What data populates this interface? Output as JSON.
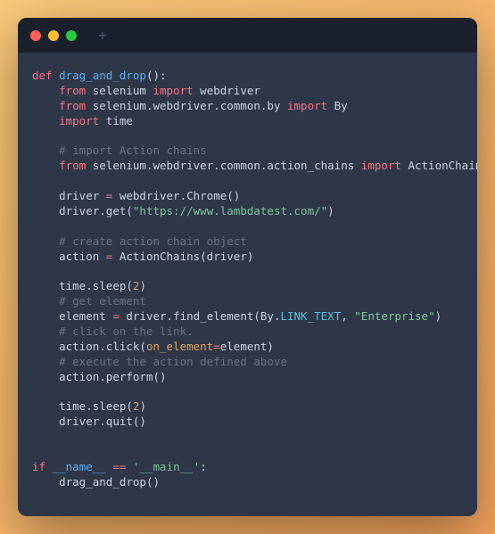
{
  "titlebar": {
    "plus": "+"
  },
  "code": {
    "l0_def": "def",
    "l0_fn": "drag_and_drop",
    "l0_rest": "():",
    "l1_from": "from",
    "l1_mod": " selenium ",
    "l1_import": "import",
    "l1_name": " webdriver",
    "l2_from": "from",
    "l2_mod": " selenium.webdriver.common.by ",
    "l2_import": "import",
    "l2_name": " By",
    "l3_import": "import",
    "l3_name": " time",
    "l5_comment": "# import Action chains",
    "l6_from": "from",
    "l6_mod": " selenium.webdriver.common.action_chains ",
    "l6_import": "import",
    "l6_name": " ActionChains",
    "l8_a": "driver ",
    "l8_eq": "=",
    "l8_b": " webdriver.Chrome()",
    "l9_a": "driver.get(",
    "l9_str": "\"https://www.lambdatest.com/\"",
    "l9_b": ")",
    "l11_comment": "# create action chain object",
    "l12_a": "action ",
    "l12_eq": "=",
    "l12_b": " ActionChains(driver)",
    "l14_a": "time.sleep(",
    "l14_num": "2",
    "l14_b": ")",
    "l15_comment": "# get element",
    "l16_a": "element ",
    "l16_eq": "=",
    "l16_b": " driver.find_element(By.",
    "l16_const": "LINK_TEXT",
    "l16_c": ", ",
    "l16_str": "\"Enterprise\"",
    "l16_d": ")",
    "l17_comment": "# click on the link.",
    "l18_a": "action.click(",
    "l18_param": "on_element",
    "l18_eq": "=",
    "l18_b": "element)",
    "l19_comment": "# execute the action defined above",
    "l20": "action.perform()",
    "l22_a": "time.sleep(",
    "l22_num": "2",
    "l22_b": ")",
    "l23": "driver.quit()",
    "l26_if": "if",
    "l26_name": "__name__",
    "l26_eq": "==",
    "l26_str": "'__main__'",
    "l26_colon": ":",
    "l27": "drag_and_drop()"
  }
}
